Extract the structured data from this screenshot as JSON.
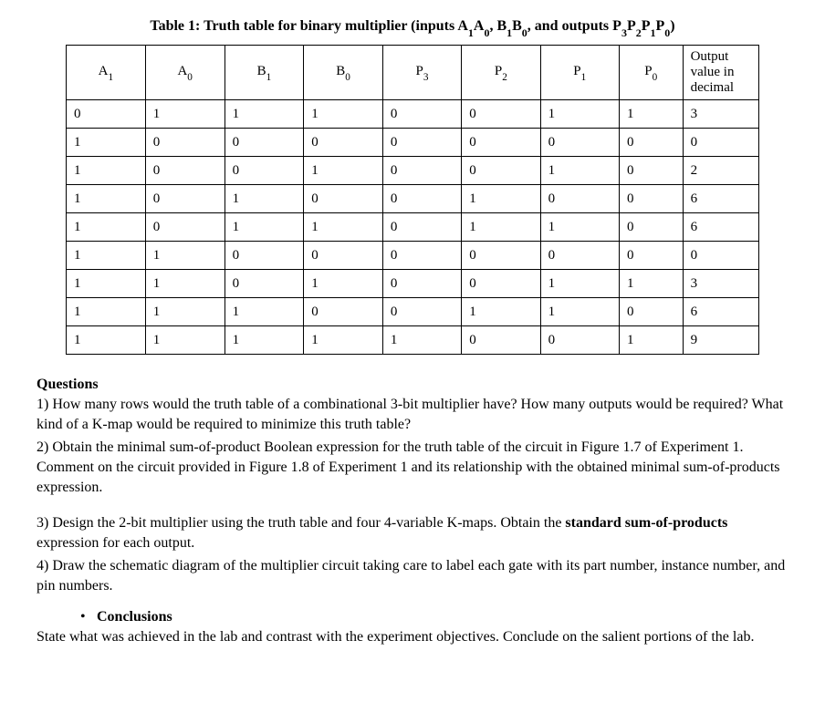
{
  "table": {
    "title_prefix": "Table 1: Truth table for binary multiplier (inputs A",
    "title_mid1": "A",
    "title_mid2": ", B",
    "title_mid3": "B",
    "title_mid4": ", and outputs P",
    "title_mid5": "P",
    "title_mid6": "P",
    "title_mid7": "P",
    "title_suffix": ")",
    "headers": {
      "a1_main": "A",
      "a1_sub": "1",
      "a0_main": "A",
      "a0_sub": "0",
      "b1_main": "B",
      "b1_sub": "1",
      "b0_main": "B",
      "b0_sub": "0",
      "p3_main": "P",
      "p3_sub": "3",
      "p2_main": "P",
      "p2_sub": "2",
      "p1_main": "P",
      "p1_sub": "1",
      "p0_main": "P",
      "p0_sub": "0",
      "output_line1": "Output",
      "output_line2": "value in",
      "output_line3": "decimal"
    },
    "rows": [
      {
        "a1": "0",
        "a0": "1",
        "b1": "1",
        "b0": "1",
        "p3": "0",
        "p2": "0",
        "p1": "1",
        "p0": "1",
        "out": "3"
      },
      {
        "a1": "1",
        "a0": "0",
        "b1": "0",
        "b0": "0",
        "p3": "0",
        "p2": "0",
        "p1": "0",
        "p0": "0",
        "out": "0"
      },
      {
        "a1": "1",
        "a0": "0",
        "b1": "0",
        "b0": "1",
        "p3": "0",
        "p2": "0",
        "p1": "1",
        "p0": "0",
        "out": "2"
      },
      {
        "a1": "1",
        "a0": "0",
        "b1": "1",
        "b0": "0",
        "p3": "0",
        "p2": "1",
        "p1": "0",
        "p0": "0",
        "out": "6"
      },
      {
        "a1": "1",
        "a0": "0",
        "b1": "1",
        "b0": "1",
        "p3": "0",
        "p2": "1",
        "p1": "1",
        "p0": "0",
        "out": "6"
      },
      {
        "a1": "1",
        "a0": "1",
        "b1": "0",
        "b0": "0",
        "p3": "0",
        "p2": "0",
        "p1": "0",
        "p0": "0",
        "out": "0"
      },
      {
        "a1": "1",
        "a0": "1",
        "b1": "0",
        "b0": "1",
        "p3": "0",
        "p2": "0",
        "p1": "1",
        "p0": "1",
        "out": "3"
      },
      {
        "a1": "1",
        "a0": "1",
        "b1": "1",
        "b0": "0",
        "p3": "0",
        "p2": "1",
        "p1": "1",
        "p0": "0",
        "out": "6"
      },
      {
        "a1": "1",
        "a0": "1",
        "b1": "1",
        "b0": "1",
        "p3": "1",
        "p2": "0",
        "p1": "0",
        "p0": "1",
        "out": "9"
      }
    ]
  },
  "questions": {
    "heading": "Questions",
    "q1": "1) How many rows would the truth table of a combinational 3-bit multiplier have? How many outputs would be required? What kind of a K-map would be required to minimize this truth table?",
    "q2": "2) Obtain the minimal sum-of-product Boolean expression for the truth table of the circuit in Figure 1.7 of Experiment 1. Comment on the circuit provided in Figure 1.8 of Experiment 1 and its relationship with the obtained minimal sum-of-products expression.",
    "q3_part1": "3) Design the 2-bit multiplier using the truth table and four 4-variable K-maps. Obtain the ",
    "q3_bold": "standard sum-of-products",
    "q3_part2": " expression for each output.",
    "q4": "4) Draw the schematic diagram of the multiplier circuit taking care to label each gate with its part number, instance number, and pin numbers."
  },
  "conclusions": {
    "bullet": "•",
    "heading": "Conclusions",
    "text": "State what was achieved in the lab and contrast with the experiment objectives. Conclude on the salient portions of the lab."
  }
}
